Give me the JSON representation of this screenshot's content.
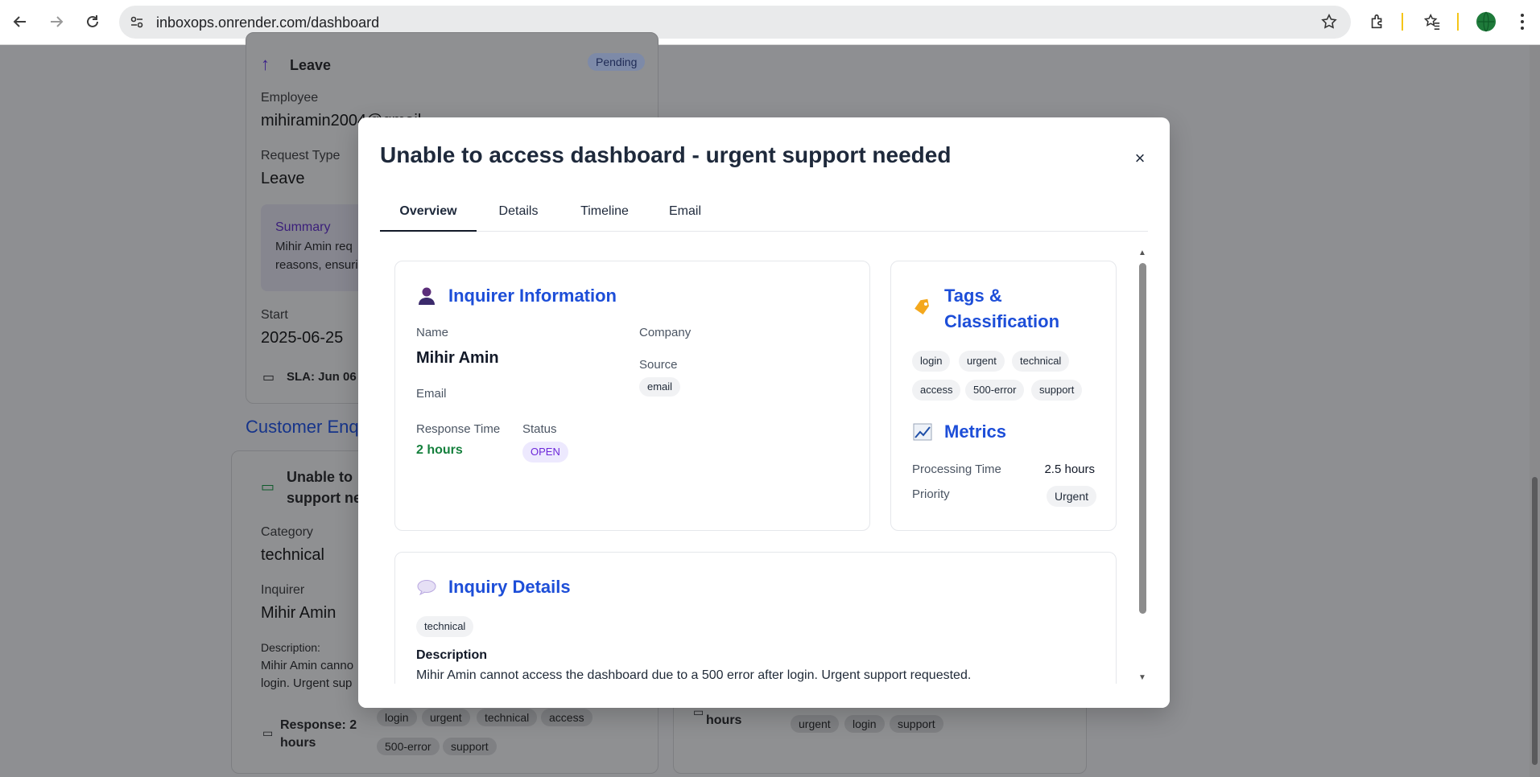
{
  "browser": {
    "url": "inboxops.onrender.com/dashboard"
  },
  "background": {
    "leave_card": {
      "title": "Leave",
      "badge": "Pending",
      "employee_label": "Employee",
      "employee_value": "mihiramin2004@gmail",
      "request_type_label": "Request Type",
      "request_type_value": "Leave",
      "summary_label": "Summary",
      "summary_line1": "Mihir Amin req",
      "summary_line2": "reasons, ensuri",
      "start_label": "Start",
      "start_value": "2025-06-25",
      "sla": "SLA: Jun 06"
    },
    "section_title": "Customer Enq",
    "inquiry_card": {
      "title_line1": "Unable to",
      "title_line2": "support ne",
      "category_label": "Category",
      "category_value": "technical",
      "inquirer_label": "Inquirer",
      "inquirer_value": "Mihir Amin",
      "description_label": "Description:",
      "description_line1": "Mihir Amin canno",
      "description_line2": "login. Urgent sup",
      "response_line1": "Response: 2",
      "response_line2": "hours",
      "tags": [
        "login",
        "urgent",
        "technical",
        "access",
        "500-error",
        "support"
      ]
    },
    "right_card": {
      "hours": "hours",
      "tags": [
        "urgent",
        "login",
        "support"
      ]
    }
  },
  "modal": {
    "title": "Unable to access dashboard - urgent support needed",
    "close_label": "×",
    "tabs": [
      {
        "label": "Overview"
      },
      {
        "label": "Details"
      },
      {
        "label": "Timeline"
      },
      {
        "label": "Email"
      }
    ],
    "inquirer": {
      "title": "Inquirer Information",
      "name_label": "Name",
      "name_value": "Mihir Amin",
      "company_label": "Company",
      "email_label": "Email",
      "source_label": "Source",
      "source_value": "email",
      "response_time_label": "Response Time",
      "response_time_value": "2 hours",
      "status_label": "Status",
      "status_value": "OPEN"
    },
    "tags": {
      "title_line1": "Tags &",
      "title_line2": "Classification",
      "items": [
        "login",
        "urgent",
        "technical",
        "access",
        "500-error",
        "support"
      ]
    },
    "metrics": {
      "title": "Metrics",
      "processing_label": "Processing Time",
      "processing_value": "2.5 hours",
      "priority_label": "Priority",
      "priority_value": "Urgent"
    },
    "inquiry_details": {
      "title": "Inquiry Details",
      "category_tag": "technical",
      "description_label": "Description",
      "description_value": "Mihir Amin cannot access the dashboard due to a 500 error after login. Urgent support requested."
    }
  },
  "colors": {
    "accent_blue": "#1d4ed8",
    "green": "#15803d",
    "status_purple": "#6d28d9"
  }
}
